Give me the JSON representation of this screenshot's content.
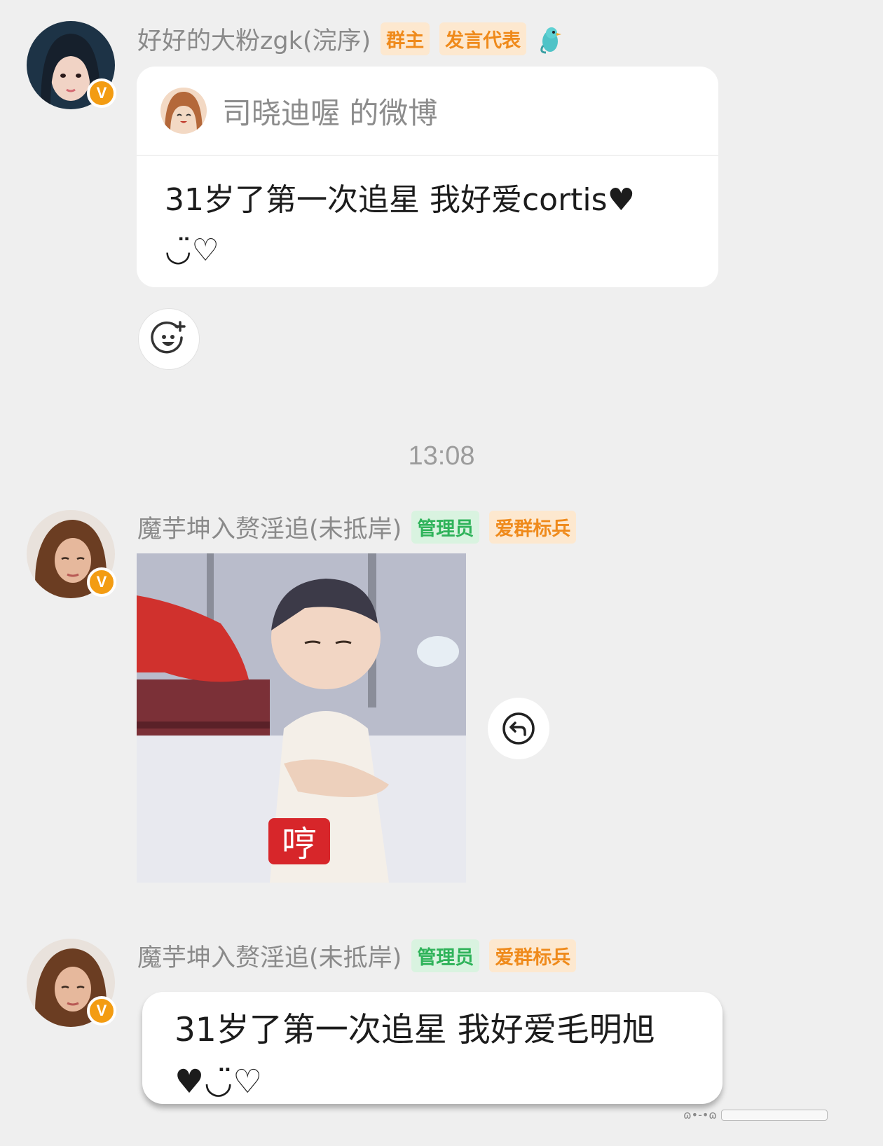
{
  "messages": [
    {
      "sender_name": "好好的大粉zgk(浣序)",
      "tags": [
        "群主",
        "发言代表"
      ],
      "card": {
        "source": "司晓迪喔 的微博",
        "text": "31岁了第一次追星 我好爱cortis♥",
        "text_line2": "◡̈♡"
      }
    },
    {
      "sender_name": "魔芋坤入赘淫追(未抵岸)",
      "tags": [
        "管理员",
        "爱群标兵"
      ],
      "sticker_text": "哼"
    },
    {
      "sender_name": "魔芋坤入赘淫追(未抵岸)",
      "tags": [
        "管理员",
        "爱群标兵"
      ],
      "text": "31岁了第一次追星 我好爱毛明旭",
      "text_line2": "♥◡̈♡"
    }
  ],
  "timestamp": "13:08",
  "badge_letter": "V",
  "colors": {
    "background": "#efefef",
    "tag_orange": "#ef8a1b",
    "tag_green": "#2fb35a",
    "verified_badge": "#f39c12"
  },
  "icons": [
    "verified-badge-icon",
    "parrot-icon",
    "add-emoji-icon",
    "reply-icon"
  ]
}
